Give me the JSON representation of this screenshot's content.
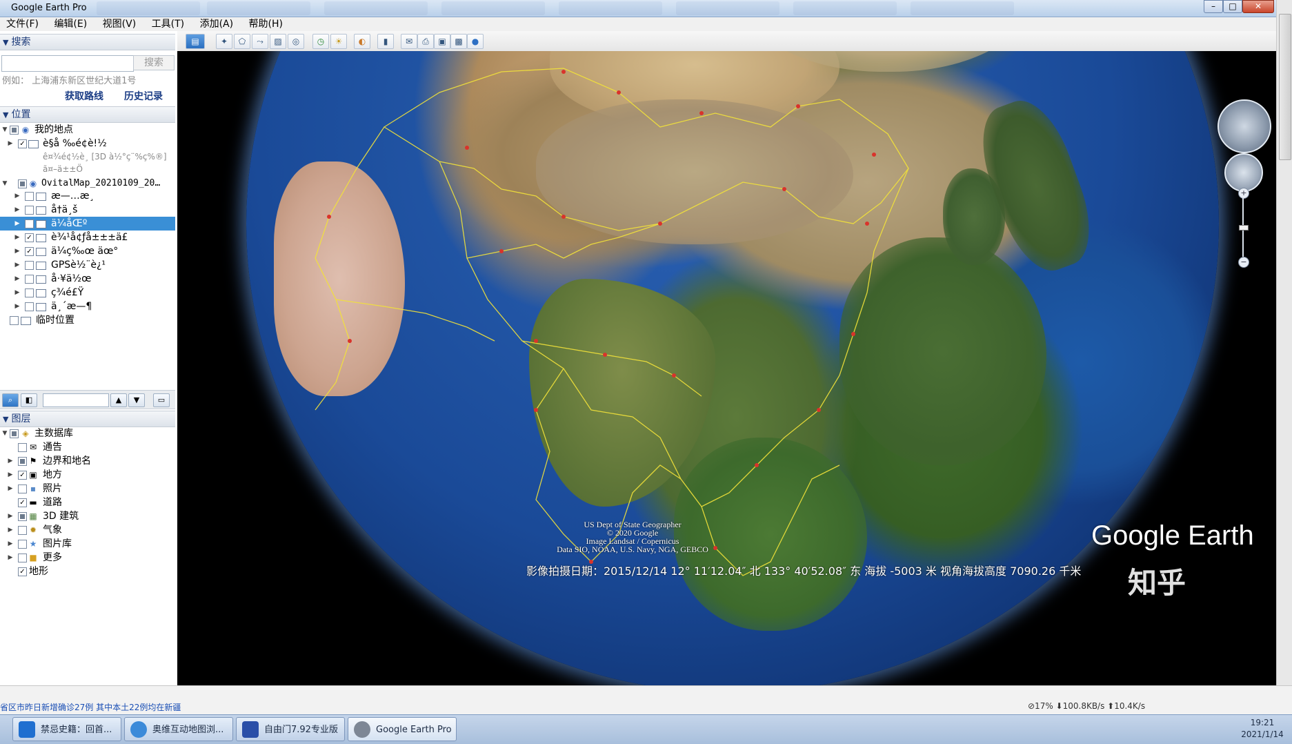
{
  "window": {
    "title": "Google Earth Pro",
    "buttons": [
      "–",
      "□",
      "✕"
    ]
  },
  "menubar": [
    "文件(F)",
    "编辑(E)",
    "视图(V)",
    "工具(T)",
    "添加(A)",
    "帮助(H)"
  ],
  "search": {
    "header": "搜索",
    "placeholder": "",
    "button": "搜索",
    "hint": "例如： 上海浦东新区世纪大道1号",
    "get_directions": "获取路线",
    "history": "历史记录"
  },
  "places": {
    "header": "位置",
    "items": [
      {
        "label": "我的地点",
        "checked": "partial",
        "expanded": true,
        "level": 0
      },
      {
        "label": "è§å ‰é¢è!½",
        "checked": "checked",
        "level": 1,
        "sub1": "ê¤¾é¢½è¸ [3D à½°ç¨%ç%®]",
        "sub2": "ã¤–ä±±Ö"
      },
      {
        "label": "OvitalMap_20210109_20…",
        "checked": "partial",
        "expanded": true,
        "level": 0
      },
      {
        "label": "æ—…æ¸",
        "checked": "",
        "level": 1
      },
      {
        "label": "å†ä¸š",
        "checked": "",
        "level": 1
      },
      {
        "label": "ä¼åŒº",
        "checked": "checked",
        "level": 1,
        "selected": true
      },
      {
        "label": "è¾¹å¢ƒå±±±ä£",
        "checked": "checked",
        "level": 1
      },
      {
        "label": "ä¼ç‰œ  äœ°",
        "checked": "checked",
        "level": 1
      },
      {
        "label": "GPSè½¨è¿¹",
        "checked": "",
        "level": 1
      },
      {
        "label": "å·¥ä½œ",
        "checked": "",
        "level": 1
      },
      {
        "label": "ç¾é£Ÿ",
        "checked": "",
        "level": 1
      },
      {
        "label": "ä¸´æ—¶",
        "checked": "",
        "level": 1
      },
      {
        "label": "临时位置",
        "checked": "",
        "level": 0
      }
    ]
  },
  "layers": {
    "header": "图层",
    "items": [
      {
        "label": "主数据库",
        "checked": "partial",
        "icon": "database-icon",
        "level": 0
      },
      {
        "label": "通告",
        "checked": "",
        "icon": "mail-icon",
        "level": 1
      },
      {
        "label": "边界和地名",
        "checked": "partial",
        "icon": "flag-icon",
        "level": 1
      },
      {
        "label": "地方",
        "checked": "checked",
        "icon": "place-icon",
        "level": 1
      },
      {
        "label": "照片",
        "checked": "",
        "icon": "photo-icon",
        "level": 1
      },
      {
        "label": "道路",
        "checked": "checked",
        "icon": "road-icon",
        "level": 1
      },
      {
        "label": "3D 建筑",
        "checked": "partial",
        "icon": "building-icon",
        "level": 1
      },
      {
        "label": "气象",
        "checked": "",
        "icon": "weather-icon",
        "level": 1
      },
      {
        "label": "图片库",
        "checked": "",
        "icon": "star-icon",
        "level": 1
      },
      {
        "label": "更多",
        "checked": "",
        "icon": "folder-icon",
        "level": 1
      },
      {
        "label": "地形",
        "checked": "checked",
        "icon": "",
        "level": 0
      }
    ]
  },
  "map": {
    "copyright": [
      "US Dept of State Geographer",
      "© 2020 Google",
      "Image Landsat / Copernicus",
      "Data SIO, NOAA, U.S. Navy, NGA, GEBCO"
    ],
    "logo": "Google Earth",
    "status": "影像拍摄日期：2015/12/14   12° 11′12.04″ 北 133° 40′52.08″ 东 海拔 -5003 米   视角海拔高度 7090.26 千米",
    "watermark": "知乎"
  },
  "browser": {
    "news": "省区市昨日新增确诊27例 其中本土22例均在新疆",
    "stats": "⊘17%  ⬇100.8KB/s  ⬆10.4K/s"
  },
  "taskbar": {
    "items": [
      {
        "label": "禁忌史籍：回首..."
      },
      {
        "label": "奥维互动地图浏..."
      },
      {
        "label": "自由门7.92专业版"
      },
      {
        "label": "Google Earth Pro"
      }
    ],
    "time": "19:21",
    "date": "2021/1/14"
  }
}
